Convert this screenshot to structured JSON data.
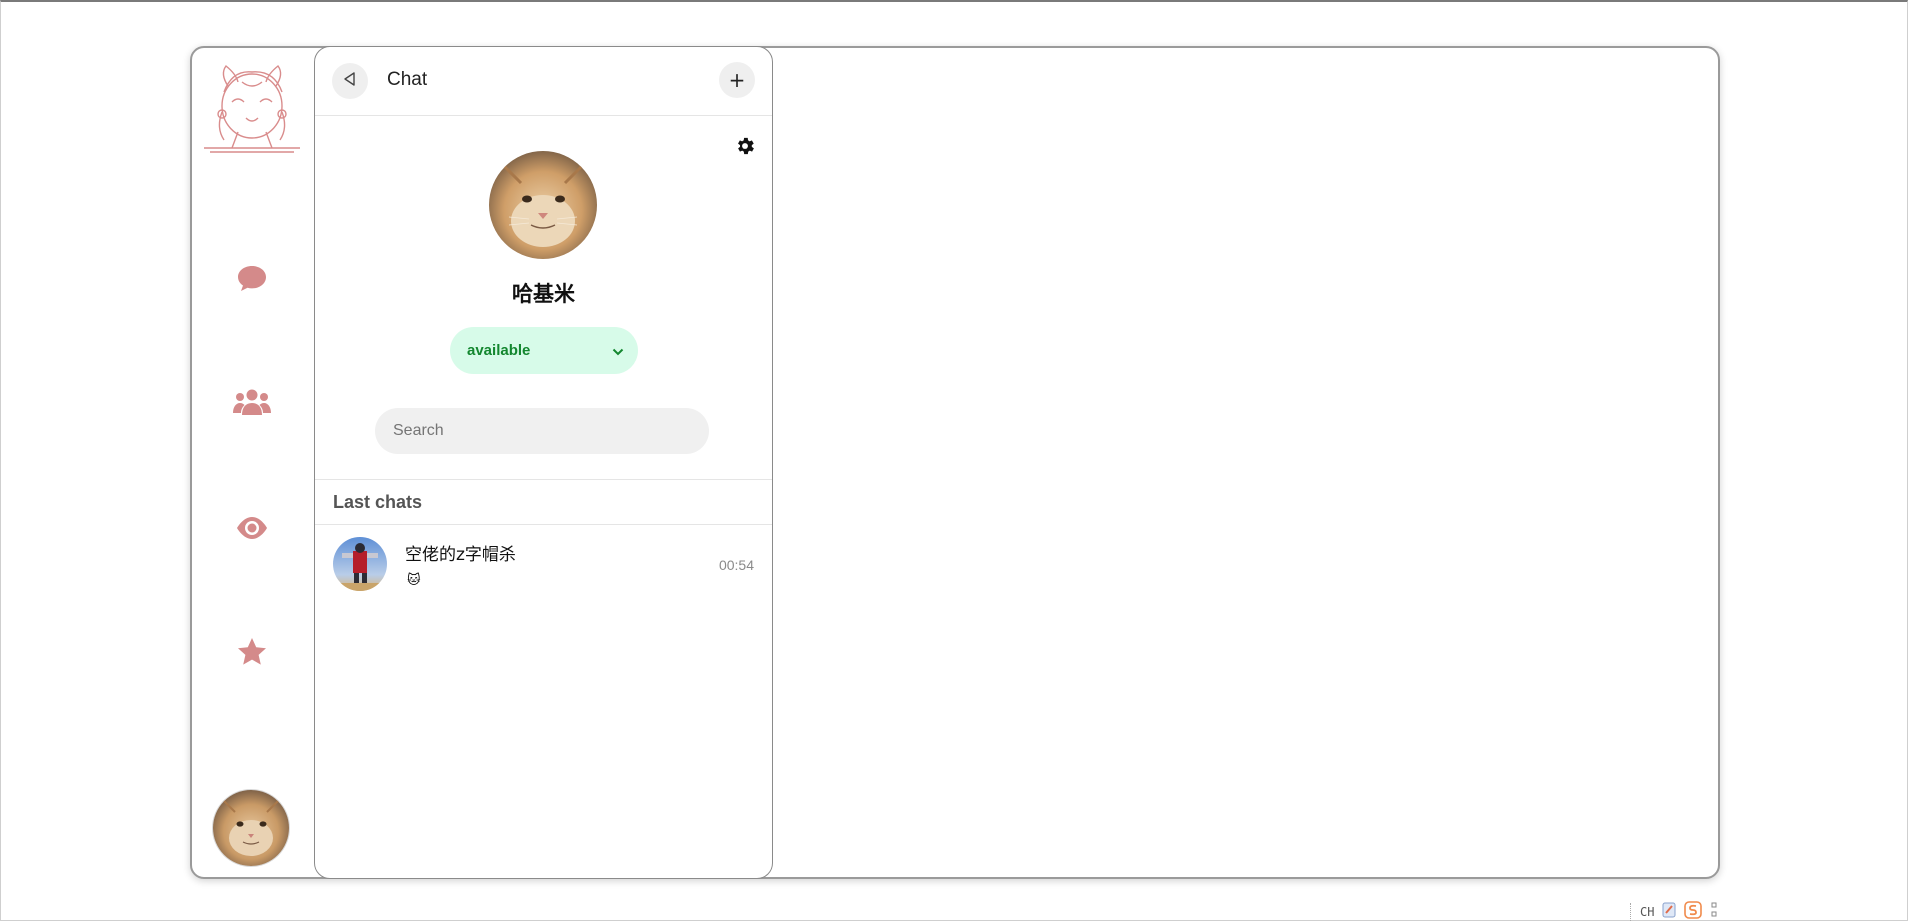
{
  "header": {
    "title": "Chat",
    "back_icon": "back-triangle-icon",
    "add_label": "+"
  },
  "rail": {
    "logo": "anime-girl-logo",
    "items": [
      {
        "icon": "chat-bubble-icon"
      },
      {
        "icon": "group-users-icon"
      },
      {
        "icon": "eye-icon"
      },
      {
        "icon": "star-icon"
      }
    ],
    "accent_color": "#d48a8a"
  },
  "profile": {
    "name": "哈基米",
    "status": "available",
    "status_color": "#13872f",
    "status_bg": "#d7fbe9"
  },
  "search": {
    "placeholder": "Search"
  },
  "last_chats": {
    "title": "Last chats",
    "items": [
      {
        "name": "空佬的z字帽杀",
        "preview": "🐱",
        "time": "00:54"
      }
    ]
  },
  "tray": {
    "ime": "CH"
  }
}
